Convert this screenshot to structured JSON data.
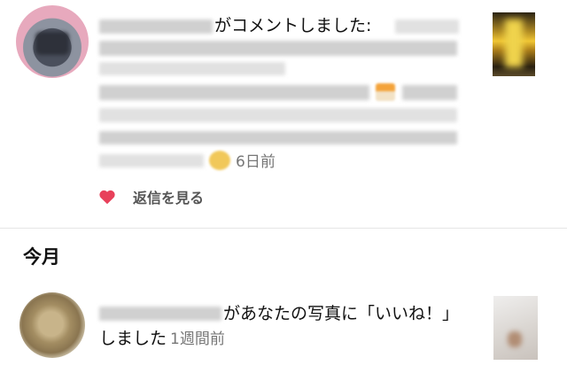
{
  "notification_1": {
    "text": "がコメントしました:",
    "time": "6日前",
    "reply_label": "返信を見る"
  },
  "section": {
    "title": "今月"
  },
  "notification_2": {
    "text_line1": "があなたの写真に「いいね！」",
    "text_line2": "しました",
    "time": "1週間前"
  },
  "colors": {
    "heart": "#e8405a",
    "time_text": "#777777",
    "divider": "#e6e6e6"
  },
  "icons": {
    "like": "heart-icon"
  }
}
